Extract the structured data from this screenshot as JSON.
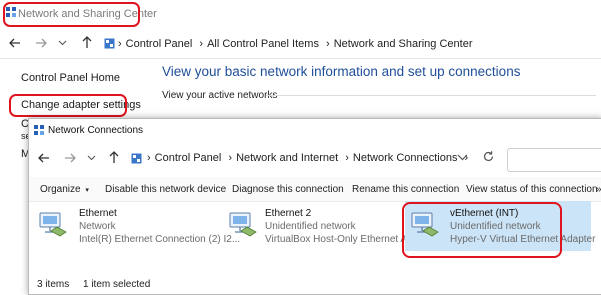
{
  "back_window": {
    "title": "Network and Sharing Center",
    "breadcrumb": [
      "Control Panel",
      "All Control Panel Items",
      "Network and Sharing Center"
    ],
    "sidebar": {
      "home": "Control Panel Home",
      "change_adapter": "Change adapter settings",
      "partial_c1": "C",
      "partial_c2": "se",
      "partial_m": "M"
    },
    "heading": "View your basic network information and set up connections",
    "subheading": "View your active networks"
  },
  "front_window": {
    "title": "Network Connections",
    "breadcrumb": [
      "Control Panel",
      "Network and Internet",
      "Network Connections"
    ],
    "commands": {
      "organize": "Organize",
      "disable": "Disable this network device",
      "diagnose": "Diagnose this connection",
      "rename": "Rename this connection",
      "view_status": "View status of this connection"
    },
    "items": [
      {
        "name": "Ethernet",
        "status": "Network",
        "adapter": "Intel(R) Ethernet Connection (2) I2..."
      },
      {
        "name": "Ethernet 2",
        "status": "Unidentified network",
        "adapter": "VirtualBox Host-Only Ethernet Ad..."
      },
      {
        "name": "vEthernet (INT)",
        "status": "Unidentified network",
        "adapter": "Hyper-V Virtual Ethernet Adapter",
        "selected": true
      }
    ],
    "status_bar": {
      "count": "3 items",
      "selected": "1 item selected"
    }
  },
  "colors": {
    "highlight_ring": "#e0141e",
    "selection": "#cce4f7",
    "heading_blue": "#1f4e99"
  }
}
